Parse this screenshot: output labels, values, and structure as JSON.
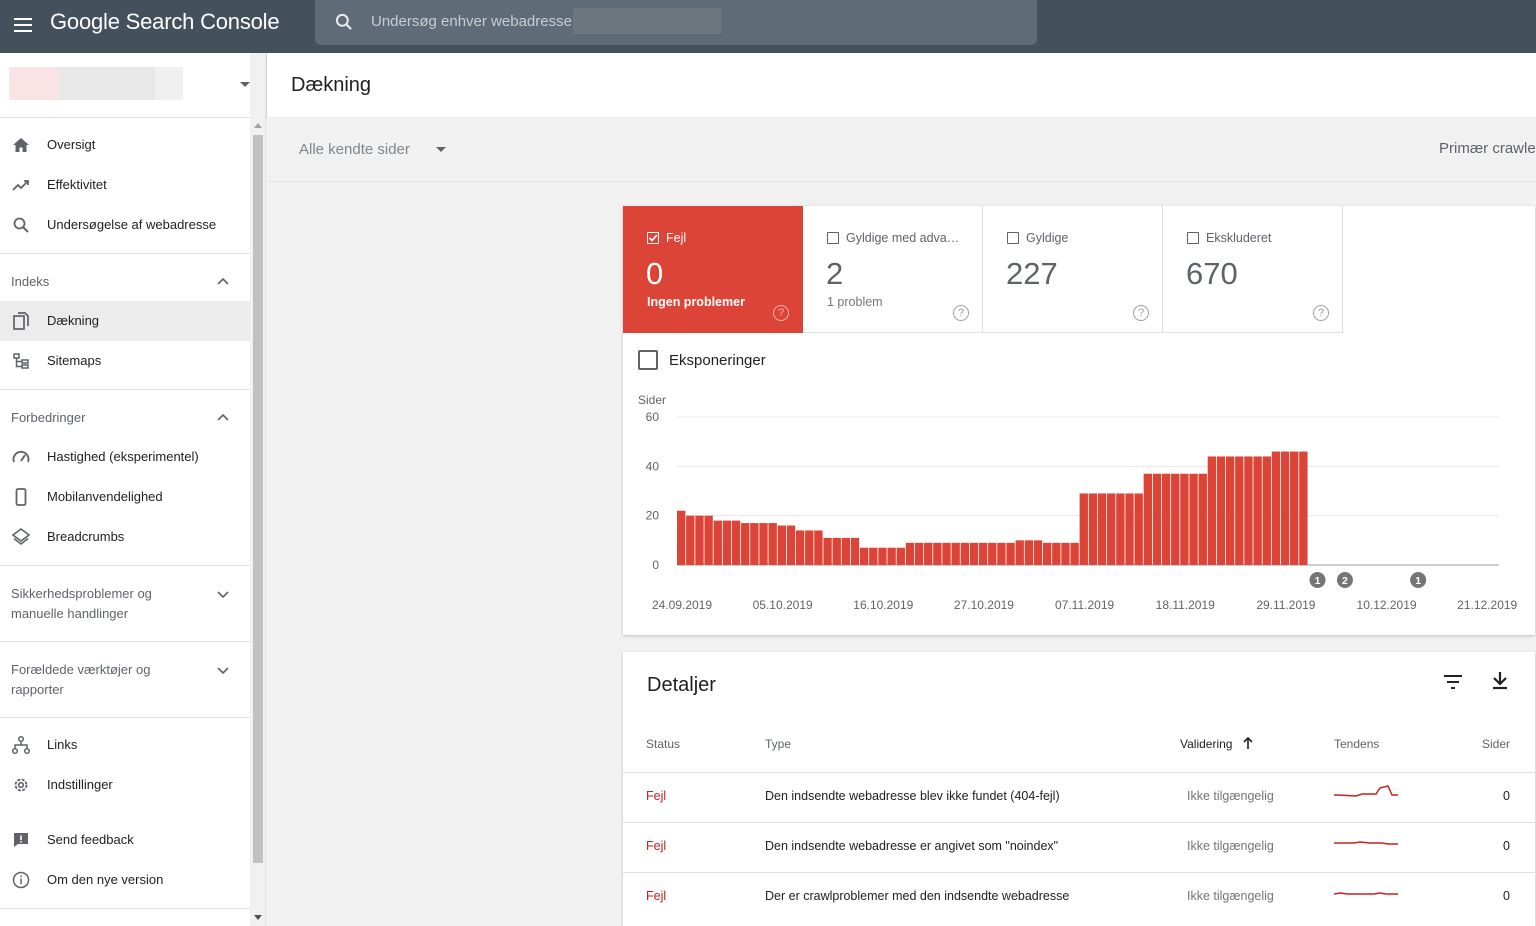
{
  "app": {
    "title": "Google Search Console",
    "search_placeholder": "Undersøg enhver webadresse"
  },
  "sidebar": {
    "nav_top": [
      {
        "label": "Oversigt",
        "icon": "home-icon"
      },
      {
        "label": "Effektivitet",
        "icon": "trending-up-icon"
      },
      {
        "label": "Undersøgelse af webadresse",
        "icon": "search-icon"
      }
    ],
    "section_index": "Indeks",
    "nav_index": [
      {
        "label": "Dækning",
        "icon": "coverage-icon",
        "active": true
      },
      {
        "label": "Sitemaps",
        "icon": "sitemap-icon"
      }
    ],
    "section_enhancements": "Forbedringer",
    "nav_enhancements": [
      {
        "label": "Hastighed (eksperimentel)",
        "icon": "speed-icon"
      },
      {
        "label": "Mobilanvendelighed",
        "icon": "phone-icon"
      },
      {
        "label": "Breadcrumbs",
        "icon": "layers-icon"
      }
    ],
    "section_security": [
      "Sikkerhedsproblemer og",
      "manuelle handlinger"
    ],
    "section_legacy": [
      "Forældede værktøjer og",
      "rapporter"
    ],
    "nav_bottom": [
      {
        "label": "Links",
        "icon": "links-icon"
      },
      {
        "label": "Indstillinger",
        "icon": "settings-icon"
      }
    ],
    "nav_footer": [
      {
        "label": "Send feedback",
        "icon": "feedback-icon"
      },
      {
        "label": "Om den nye version",
        "icon": "info-icon"
      }
    ]
  },
  "page": {
    "title": "Dækning",
    "filter": "Alle kendte sider",
    "crawler": "Primær crawler"
  },
  "tiles": [
    {
      "label": "Fejl",
      "value": "0",
      "sub": "Ingen problemer",
      "checked": true,
      "color": "#db4437"
    },
    {
      "label": "Gyldige med adva…",
      "value": "2",
      "sub": "1 problem",
      "checked": false
    },
    {
      "label": "Gyldige",
      "value": "227",
      "sub": "",
      "checked": false
    },
    {
      "label": "Ekskluderet",
      "value": "670",
      "sub": "",
      "checked": false
    }
  ],
  "impressions_label": "Eksponeringer",
  "chart_data": {
    "type": "bar",
    "ylabel": "Sider",
    "ylim": [
      0,
      60
    ],
    "yticks": [
      0,
      20,
      40,
      60
    ],
    "xticks": [
      "24.09.2019",
      "05.10.2019",
      "16.10.2019",
      "27.10.2019",
      "07.11.2019",
      "18.11.2019",
      "29.11.2019",
      "10.12.2019",
      "21.12.2019"
    ],
    "color": "#db4437",
    "values": [
      22,
      20,
      20,
      20,
      18,
      18,
      18,
      17,
      17,
      17,
      17,
      16,
      16,
      14,
      14,
      14,
      11,
      11,
      11,
      11,
      7,
      7,
      7,
      7,
      7,
      9,
      9,
      9,
      9,
      9,
      9,
      9,
      9,
      9,
      9,
      9,
      9,
      10,
      10,
      10,
      9,
      9,
      9,
      9,
      29,
      29,
      29,
      29,
      29,
      29,
      29,
      37,
      37,
      37,
      37,
      37,
      37,
      37,
      44,
      44,
      44,
      44,
      44,
      44,
      44,
      46,
      46,
      46,
      46
    ],
    "annotations": [
      {
        "label": "1",
        "day": 70
      },
      {
        "label": "2",
        "day": 73
      },
      {
        "label": "1",
        "day": 81
      }
    ]
  },
  "details": {
    "title": "Detaljer",
    "columns": [
      "Status",
      "Type",
      "Validering",
      "Tendens",
      "Sider"
    ],
    "rows": [
      {
        "status": "Fejl",
        "type": "Den indsendte webadresse blev ikke fundet (404-fejl)",
        "validation": "Ikke tilgængelig",
        "pages": "0"
      },
      {
        "status": "Fejl",
        "type": "Den indsendte webadresse er angivet som \"noindex\"",
        "validation": "Ikke tilgængelig",
        "pages": "0"
      },
      {
        "status": "Fejl",
        "type": "Der er crawlproblemer med den indsendte webadresse",
        "validation": "Ikke tilgængelig",
        "pages": "0"
      }
    ]
  }
}
